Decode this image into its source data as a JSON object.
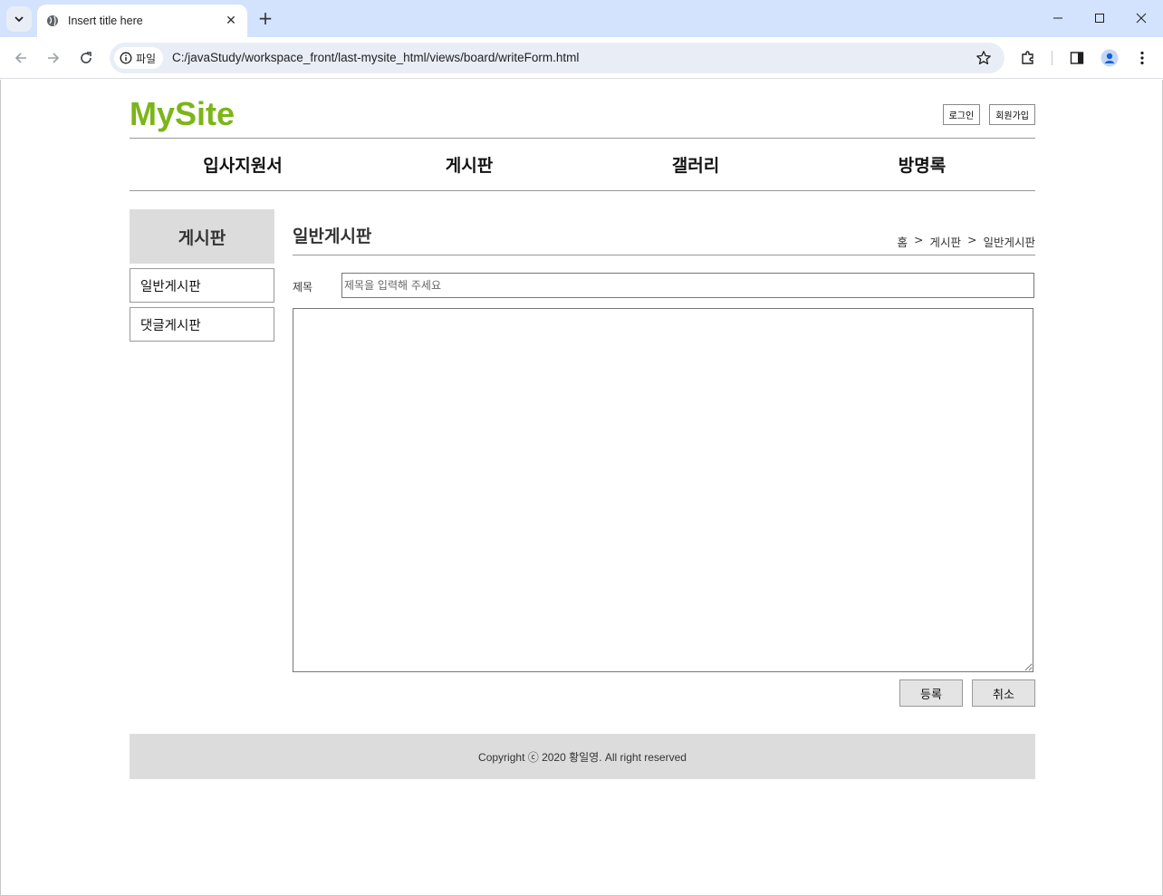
{
  "browser": {
    "tab_title": "Insert title here",
    "site_chip": "파일",
    "url": "C:/javaStudy/workspace_front/last-mysite_html/views/board/writeForm.html"
  },
  "header": {
    "logo": "MySite",
    "login_label": "로그인",
    "join_label": "회원가입"
  },
  "nav": {
    "items": [
      "입사지원서",
      "게시판",
      "갤러리",
      "방명록"
    ]
  },
  "aside": {
    "title": "게시판",
    "items": [
      "일반게시판",
      "댓글게시판"
    ]
  },
  "content": {
    "title": "일반게시판",
    "breadcrumb": [
      "홈",
      ">",
      "게시판",
      ">",
      "일반게시판"
    ],
    "form": {
      "title_label": "제목",
      "title_placeholder": "제목을 입력해 주세요",
      "title_value": "",
      "body_value": "",
      "submit_label": "등록",
      "cancel_label": "취소"
    }
  },
  "footer": {
    "text": "Copyright ⓒ 2020 황일영. All right reserved"
  },
  "colors": {
    "logo": "#7cb518",
    "chrome": "#d3e3fd",
    "aside_title_bg": "#dcdcdc"
  }
}
